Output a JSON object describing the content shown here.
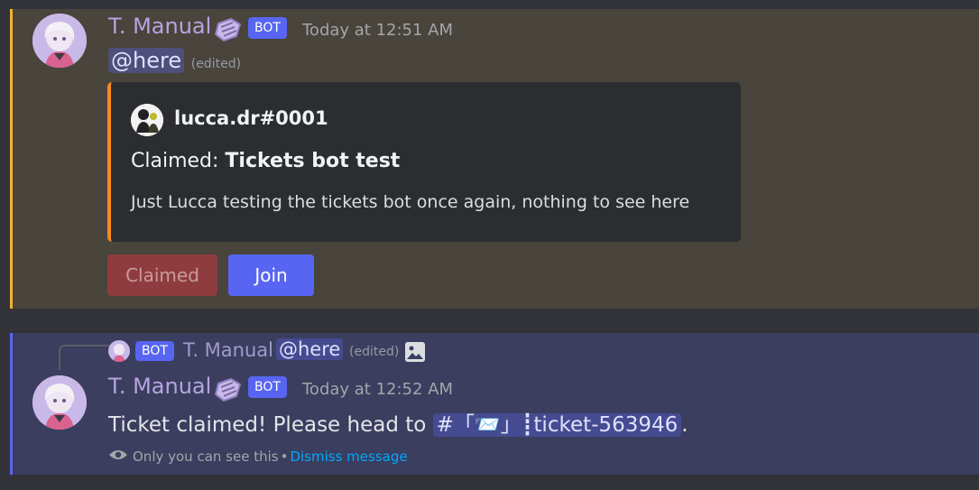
{
  "message1": {
    "author": "T. Manual",
    "bot_badge": "BOT",
    "timestamp": "Today at 12:51 AM",
    "mention": "@here",
    "edited": "(edited)",
    "embed": {
      "author": "lucca.dr#0001",
      "title_prefix": "Claimed: ",
      "title_bold": "Tickets bot test",
      "description": "Just Lucca testing the tickets bot once again, nothing to see here",
      "accent_color": "#ff8a1f"
    },
    "buttons": {
      "claimed": "Claimed",
      "join": "Join"
    },
    "highlight_color": "#f0b232"
  },
  "message2": {
    "reply": {
      "bot_badge": "BOT",
      "author": "T. Manual",
      "mention": "@here",
      "edited": "(edited)"
    },
    "author": "T. Manual",
    "bot_badge": "BOT",
    "timestamp": "Today at 12:52 AM",
    "text": "Ticket claimed! Please head to ",
    "channel": "#「📨」┋ticket-563946",
    "text_end": ".",
    "ephemeral": {
      "note": "Only you can see this",
      "separator": "•",
      "dismiss": "Dismiss message"
    },
    "highlight_color": "#5865f2"
  }
}
